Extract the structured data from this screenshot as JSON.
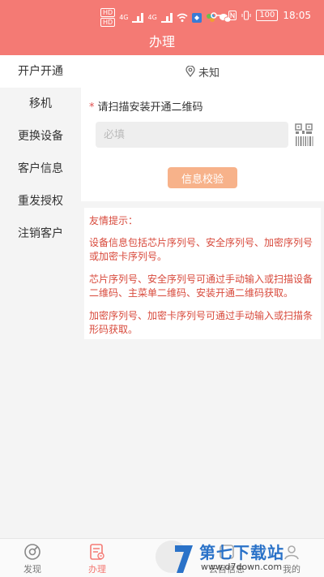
{
  "statusbar": {
    "hd1": "HD",
    "hd2": "HD",
    "net1": "4G",
    "net2": "4G",
    "battery": "100",
    "time": "18:05"
  },
  "header": {
    "title": "办理"
  },
  "sidebar": {
    "items": [
      {
        "label": "开户开通",
        "active": true
      },
      {
        "label": "移机"
      },
      {
        "label": "更换设备"
      },
      {
        "label": "客户信息"
      },
      {
        "label": "重发授权"
      },
      {
        "label": "注销客户"
      }
    ]
  },
  "location": {
    "text": "未知",
    "icon": "location-pin-icon"
  },
  "form": {
    "required_mark": "*",
    "label": "请扫描安装开通二维码",
    "placeholder": "必填",
    "value": "",
    "verify_label": "信息校验"
  },
  "tips": {
    "title": "友情提示：",
    "lines": [
      "设备信息包括芯片序列号、安全序列号、加密序列号或加密卡序列号。",
      "芯片序列号、安全序列号可通过手动输入或扫描设备二维码、主菜单二维码、安装开通二维码获取。",
      "加密序列号、加密卡序列号可通过手动输入或扫描条形码获取。"
    ]
  },
  "tabbar": {
    "tabs": [
      {
        "label": "发现"
      },
      {
        "label": "办理",
        "active": true
      },
      {
        "label": "云目信息"
      },
      {
        "label": "我的"
      }
    ]
  },
  "watermark": {
    "brand": "第七下载站",
    "url": "www.d7down.com"
  },
  "colors": {
    "accent": "#f47a74",
    "button": "#f7b28a",
    "tip_text": "#d84a3c"
  }
}
